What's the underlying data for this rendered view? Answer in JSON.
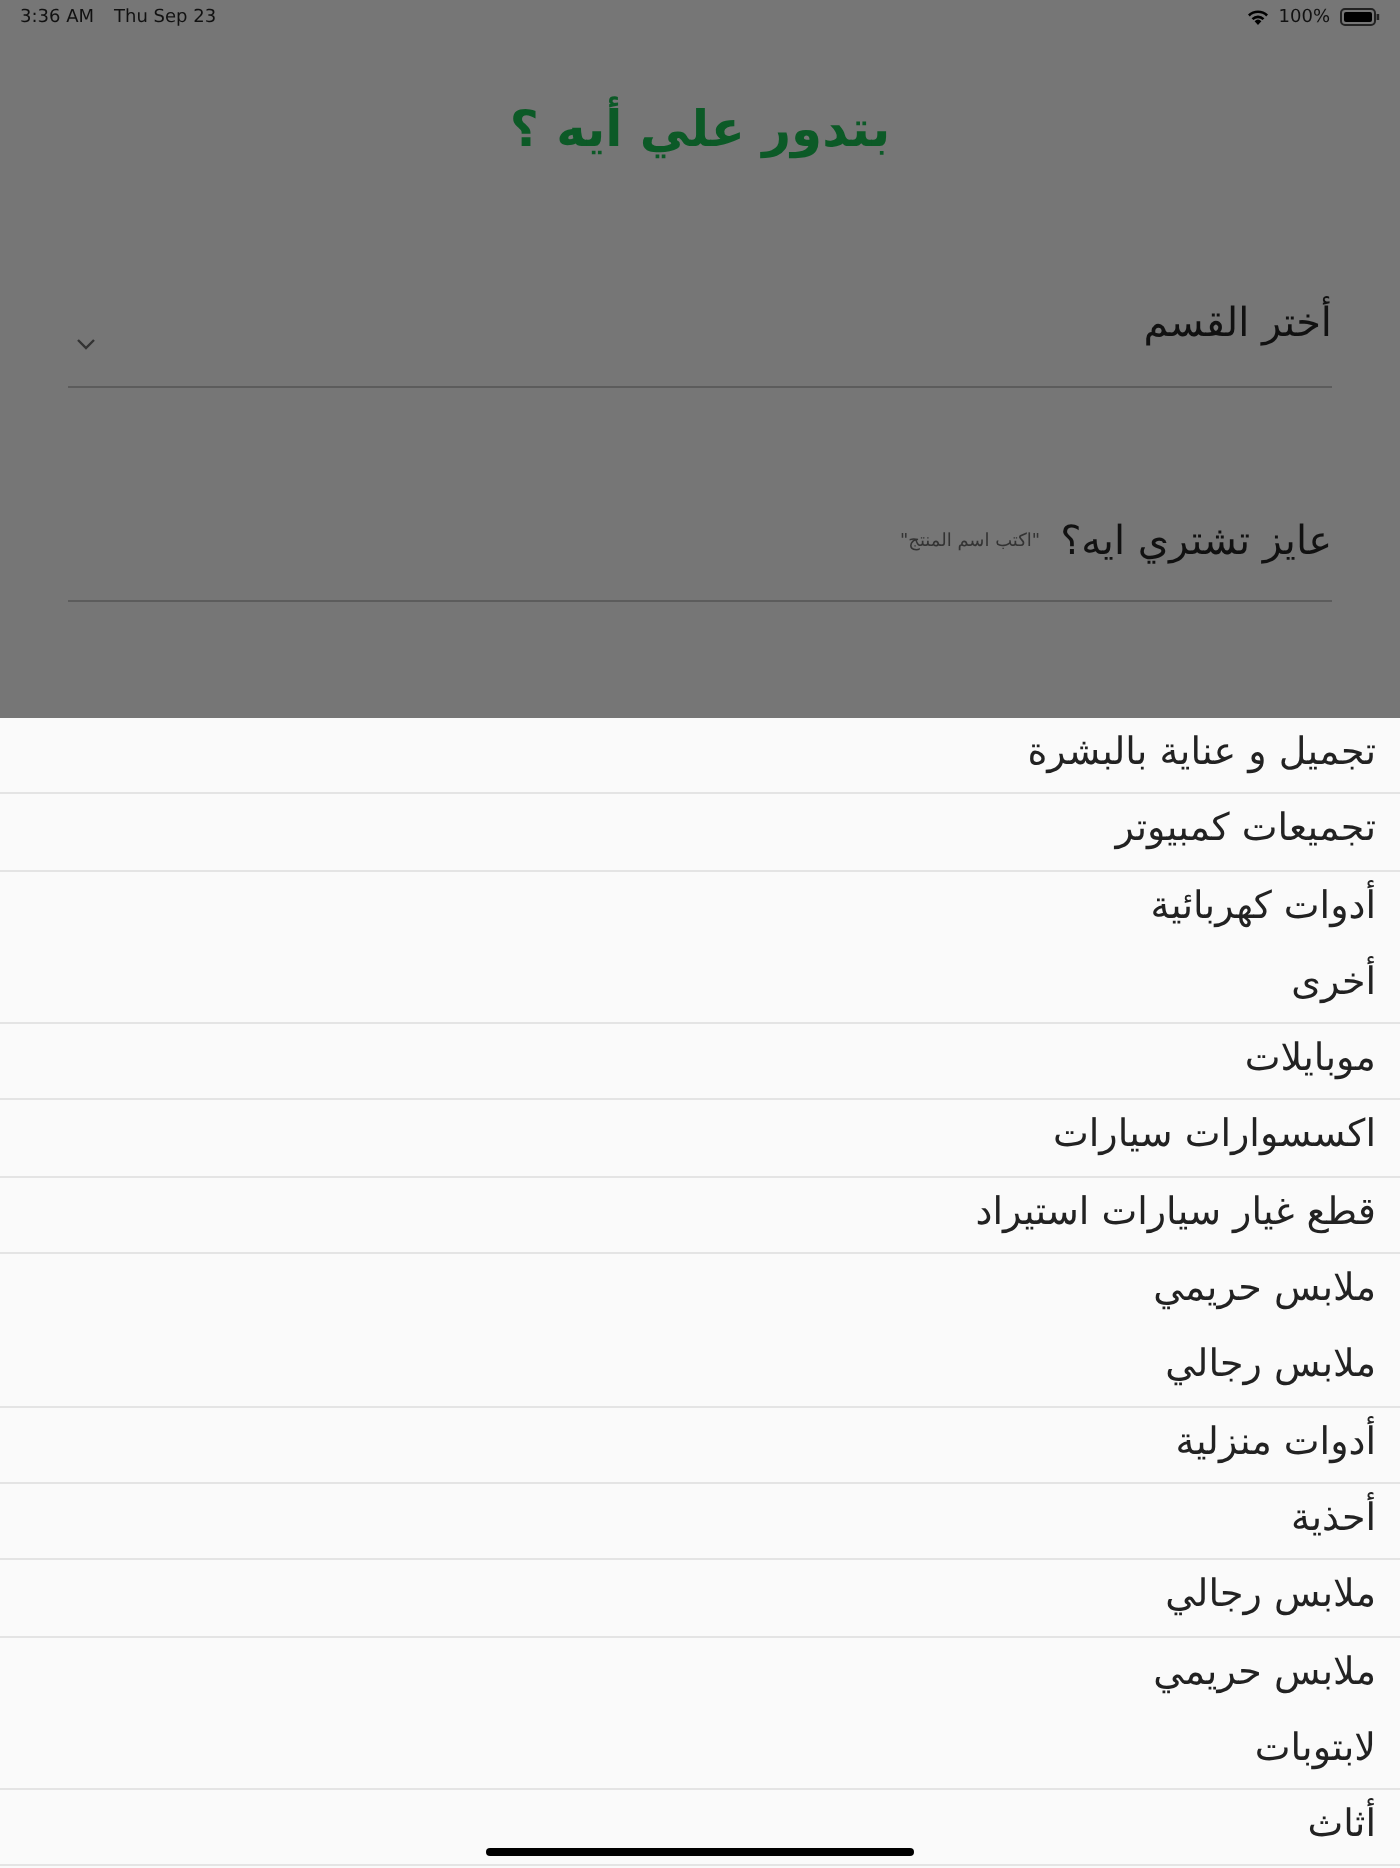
{
  "status_bar": {
    "time": "3:36 AM",
    "date": "Thu Sep 23",
    "battery": "100%"
  },
  "title": "بتدور علي أيه ؟",
  "category_field": {
    "label": "أختر القسم"
  },
  "product_field": {
    "label": "عايز تشتري ايه؟",
    "placeholder": "\"اكتب اسم المنتج\""
  },
  "dropdown_items": [
    {
      "label": "تجميل و عناية بالبشرة",
      "separator": true
    },
    {
      "label": "تجميعات كمبيوتر",
      "separator": true
    },
    {
      "label": "أدوات كهربائية",
      "separator": false
    },
    {
      "label": "أخرى",
      "separator": true
    },
    {
      "label": "موبايلات",
      "separator": true
    },
    {
      "label": "اكسسوارات سيارات",
      "separator": true
    },
    {
      "label": "قطع غيار سيارات استيراد",
      "separator": true
    },
    {
      "label": "ملابس حريمي",
      "separator": false
    },
    {
      "label": "ملابس رجالي",
      "separator": true
    },
    {
      "label": "أدوات منزلية",
      "separator": true
    },
    {
      "label": "أحذية",
      "separator": true
    },
    {
      "label": "ملابس رجالي",
      "separator": true
    },
    {
      "label": "ملابس حريمي",
      "separator": false
    },
    {
      "label": "لابتوبات",
      "separator": true
    },
    {
      "label": "أثاث",
      "separator": true
    }
  ]
}
